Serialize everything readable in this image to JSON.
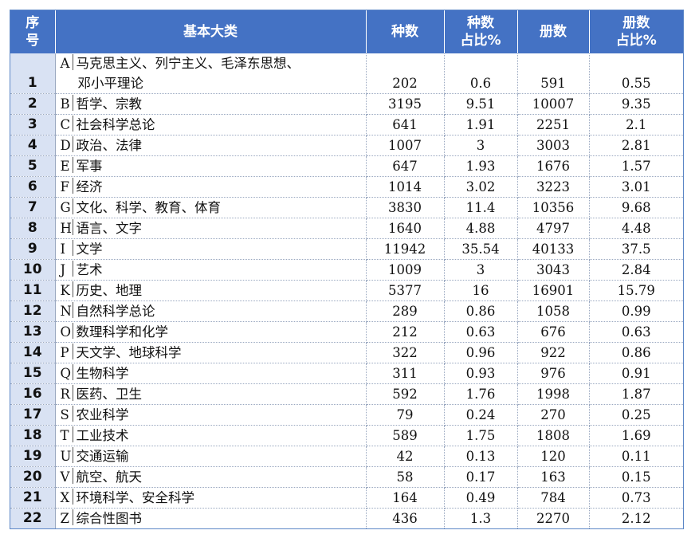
{
  "header": {
    "idx": "序号",
    "category": "基本大类",
    "kinds": "种数",
    "kinds_pct": "种数占比%",
    "volumes": "册数",
    "volumes_pct": "册数占比%"
  },
  "rows": [
    {
      "idx": "1",
      "code": "A",
      "name_line1": "马克思主义、列宁主义、毛泽东思想、",
      "name_line2": "邓小平理论",
      "kinds": "202",
      "kinds_pct": "0.6",
      "volumes": "591",
      "volumes_pct": "0.55"
    },
    {
      "idx": "2",
      "code": "B",
      "name": "哲学、宗教",
      "kinds": "3195",
      "kinds_pct": "9.51",
      "volumes": "10007",
      "volumes_pct": "9.35"
    },
    {
      "idx": "3",
      "code": "C",
      "name": "社会科学总论",
      "kinds": "641",
      "kinds_pct": "1.91",
      "volumes": "2251",
      "volumes_pct": "2.1"
    },
    {
      "idx": "4",
      "code": "D",
      "name": "政治、法律",
      "kinds": "1007",
      "kinds_pct": "3",
      "volumes": "3003",
      "volumes_pct": "2.81"
    },
    {
      "idx": "5",
      "code": "E",
      "name": "军事",
      "kinds": "647",
      "kinds_pct": "1.93",
      "volumes": "1676",
      "volumes_pct": "1.57"
    },
    {
      "idx": "6",
      "code": "F",
      "name": "经济",
      "kinds": "1014",
      "kinds_pct": "3.02",
      "volumes": "3223",
      "volumes_pct": "3.01"
    },
    {
      "idx": "7",
      "code": "G",
      "name": "文化、科学、教育、体育",
      "kinds": "3830",
      "kinds_pct": "11.4",
      "volumes": "10356",
      "volumes_pct": "9.68"
    },
    {
      "idx": "8",
      "code": "H",
      "name": "语言、文字",
      "kinds": "1640",
      "kinds_pct": "4.88",
      "volumes": "4797",
      "volumes_pct": "4.48"
    },
    {
      "idx": "9",
      "code": "I",
      "name": "文学",
      "kinds": "11942",
      "kinds_pct": "35.54",
      "volumes": "40133",
      "volumes_pct": "37.5"
    },
    {
      "idx": "10",
      "code": "J",
      "name": "艺术",
      "kinds": "1009",
      "kinds_pct": "3",
      "volumes": "3043",
      "volumes_pct": "2.84"
    },
    {
      "idx": "11",
      "code": "K",
      "name": "历史、地理",
      "kinds": "5377",
      "kinds_pct": "16",
      "volumes": "16901",
      "volumes_pct": "15.79"
    },
    {
      "idx": "12",
      "code": "N",
      "name": "自然科学总论",
      "kinds": "289",
      "kinds_pct": "0.86",
      "volumes": "1058",
      "volumes_pct": "0.99"
    },
    {
      "idx": "13",
      "code": "O",
      "name": "数理科学和化学",
      "kinds": "212",
      "kinds_pct": "0.63",
      "volumes": "676",
      "volumes_pct": "0.63"
    },
    {
      "idx": "14",
      "code": "P",
      "name": "天文学、地球科学",
      "kinds": "322",
      "kinds_pct": "0.96",
      "volumes": "922",
      "volumes_pct": "0.86"
    },
    {
      "idx": "15",
      "code": "Q",
      "name": "生物科学",
      "kinds": "311",
      "kinds_pct": "0.93",
      "volumes": "976",
      "volumes_pct": "0.91"
    },
    {
      "idx": "16",
      "code": "R",
      "name": "医药、卫生",
      "kinds": "592",
      "kinds_pct": "1.76",
      "volumes": "1998",
      "volumes_pct": "1.87"
    },
    {
      "idx": "17",
      "code": "S",
      "name": "农业科学",
      "kinds": "79",
      "kinds_pct": "0.24",
      "volumes": "270",
      "volumes_pct": "0.25"
    },
    {
      "idx": "18",
      "code": "T",
      "name": "工业技术",
      "kinds": "589",
      "kinds_pct": "1.75",
      "volumes": "1808",
      "volumes_pct": "1.69"
    },
    {
      "idx": "19",
      "code": "U",
      "name": "交通运输",
      "kinds": "42",
      "kinds_pct": "0.13",
      "volumes": "120",
      "volumes_pct": "0.11"
    },
    {
      "idx": "20",
      "code": "V",
      "name": "航空、航天",
      "kinds": "58",
      "kinds_pct": "0.17",
      "volumes": "163",
      "volumes_pct": "0.15"
    },
    {
      "idx": "21",
      "code": "X",
      "name": "环境科学、安全科学",
      "kinds": "164",
      "kinds_pct": "0.49",
      "volumes": "784",
      "volumes_pct": "0.73"
    },
    {
      "idx": "22",
      "code": "Z",
      "name": "综合性图书",
      "kinds": "436",
      "kinds_pct": "1.3",
      "volumes": "2270",
      "volumes_pct": "2.12"
    }
  ],
  "colors": {
    "header_bg": "#4472c4",
    "index_col_bg": "#d9e2f3"
  }
}
